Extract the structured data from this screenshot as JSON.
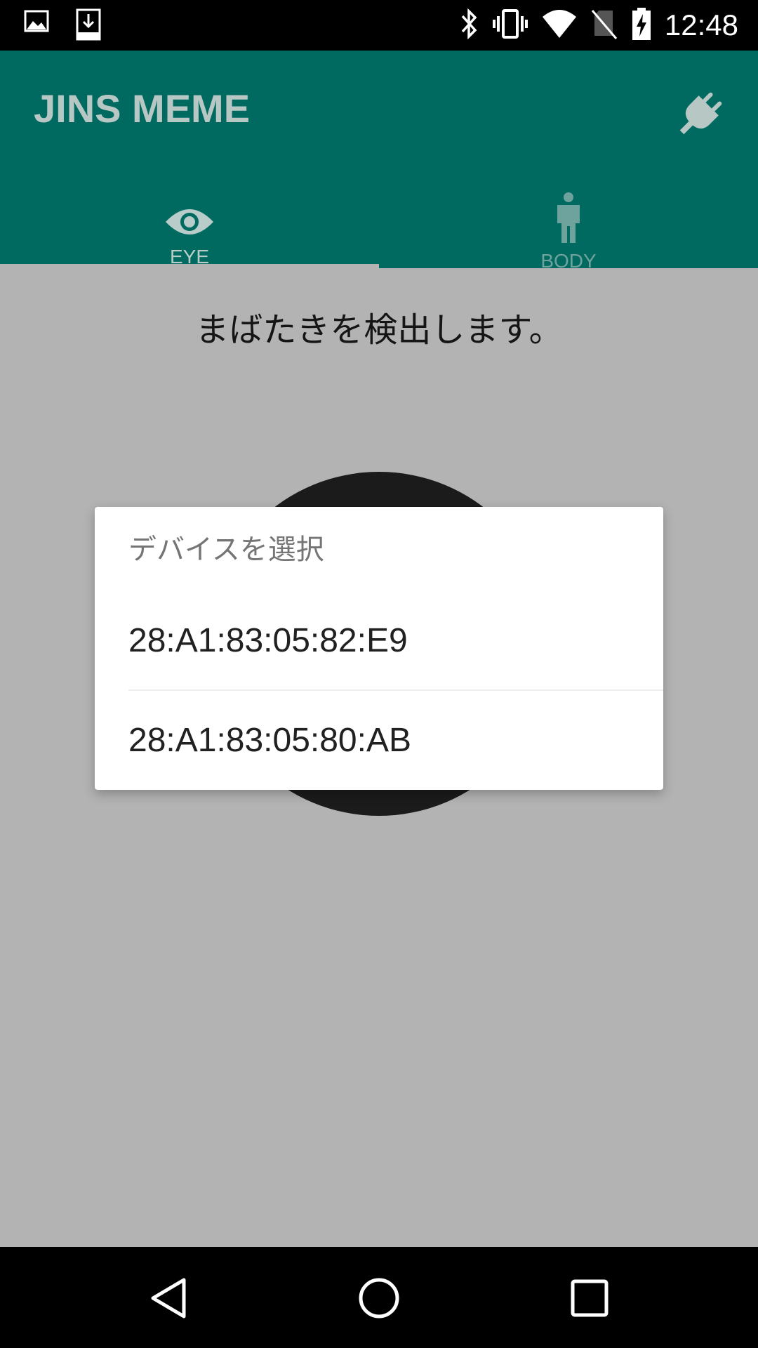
{
  "status_bar": {
    "time": "12:48",
    "left_icons": [
      "image-icon",
      "download-icon"
    ],
    "right_icons": [
      "bluetooth-icon",
      "vibrate-icon",
      "wifi-icon",
      "no-sim-icon",
      "battery-charging-icon"
    ]
  },
  "app_bar": {
    "title": "JINS MEME",
    "action_icon": "plug-icon"
  },
  "tabs": [
    {
      "label": "EYE",
      "icon": "eye-icon",
      "selected": true
    },
    {
      "label": "BODY",
      "icon": "person-icon",
      "selected": false
    }
  ],
  "main": {
    "description": "まばたきを検出します。"
  },
  "dialog": {
    "title": "デバイスを選択",
    "devices": [
      {
        "label": "28:A1:83:05:82:E9"
      },
      {
        "label": "28:A1:83:05:80:AB"
      }
    ]
  },
  "nav_bar": {
    "buttons": [
      "back-icon",
      "home-icon",
      "recents-icon"
    ]
  },
  "colors": {
    "app_bar": "#006a60",
    "content_background": "#b3b3b3",
    "dialog_background": "#ffffff",
    "dark_circle": "#1b1b1b"
  }
}
